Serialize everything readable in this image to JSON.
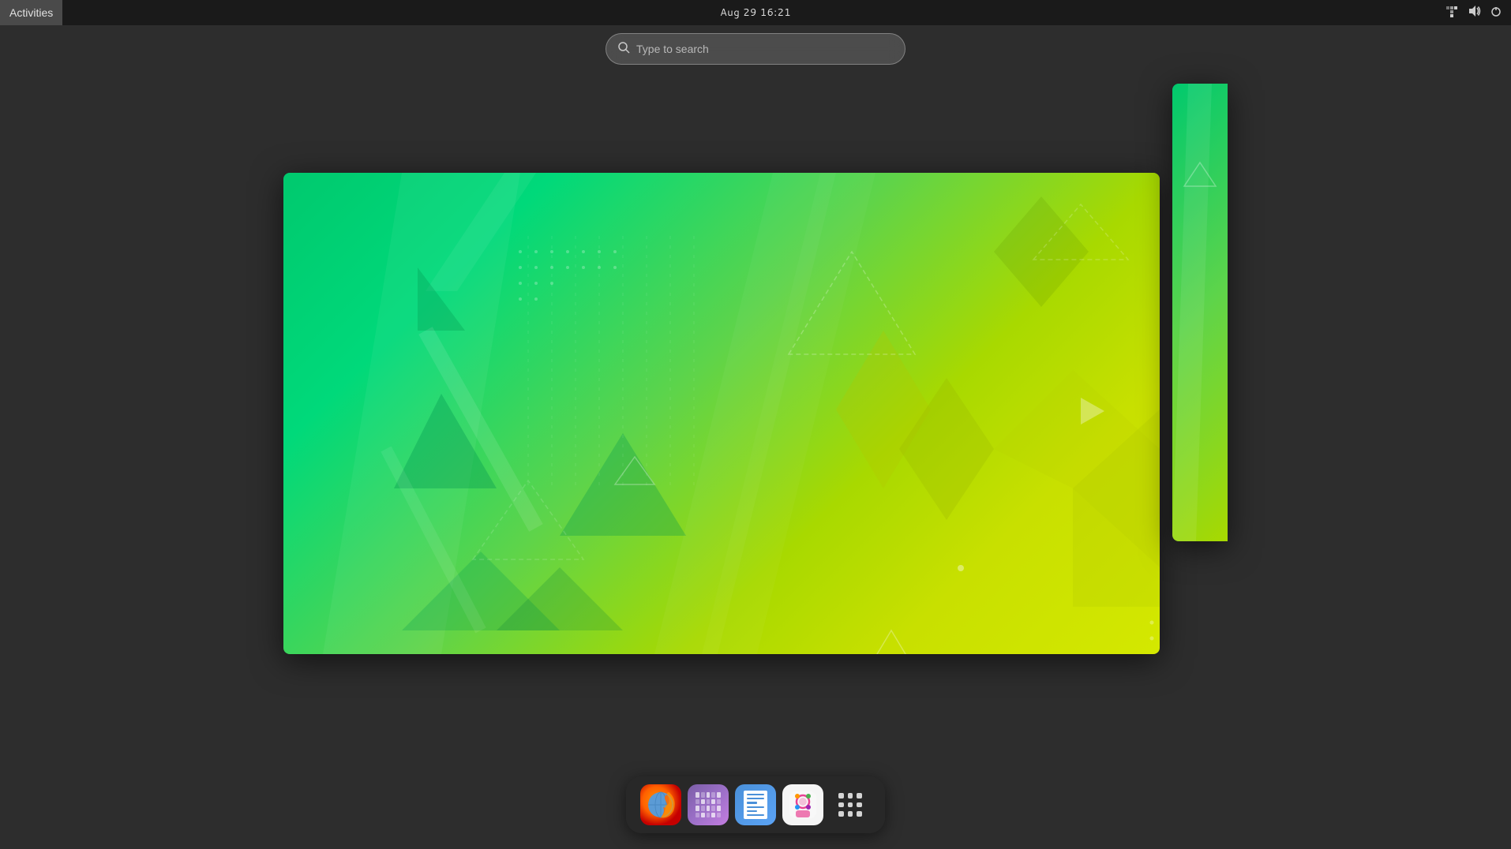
{
  "topbar": {
    "activities_label": "Activities",
    "clock": "Aug 29  16:21"
  },
  "search": {
    "placeholder": "Type to search"
  },
  "dock": {
    "items": [
      {
        "id": "firefox",
        "label": "Firefox Web Browser"
      },
      {
        "id": "calendar",
        "label": "GNOME Calendar"
      },
      {
        "id": "documents",
        "label": "Documents"
      },
      {
        "id": "software",
        "label": "Software"
      },
      {
        "id": "appgrid",
        "label": "Show Applications"
      }
    ]
  },
  "tray": {
    "network_icon": "⬡",
    "sound_icon": "🔊",
    "power_icon": "⏻"
  }
}
